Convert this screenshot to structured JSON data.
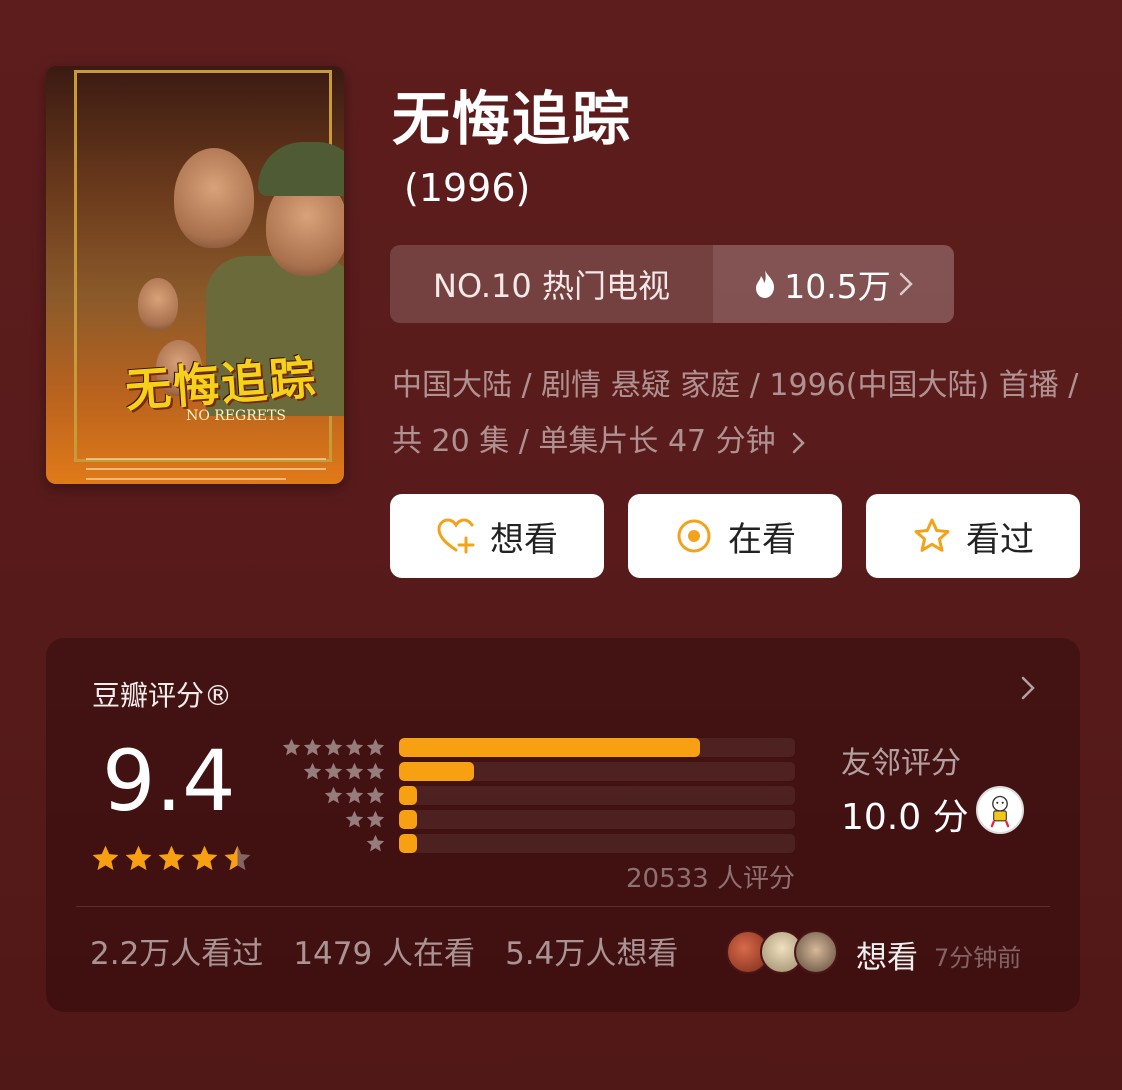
{
  "poster": {
    "title_text": "无悔追踪",
    "subtitle_text": "NO REGRETS"
  },
  "movie": {
    "title": "无悔追踪",
    "year": "(1996)"
  },
  "rank": {
    "label": "NO.10 热门电视",
    "hot_value": "10.5万"
  },
  "meta": {
    "line": "中国大陆 / 剧情 悬疑 家庭 / 1996(中国大陆) 首播 / 共 20 集 / 单集片长 47 分钟"
  },
  "actions": {
    "want": "想看",
    "watching": "在看",
    "watched": "看过"
  },
  "rating": {
    "label": "豆瓣评分®",
    "score": "9.4",
    "stars_value": 4.5,
    "distribution": [
      {
        "stars": 5,
        "fraction": 0.76
      },
      {
        "stars": 4,
        "fraction": 0.19
      },
      {
        "stars": 3,
        "fraction": 0.045
      },
      {
        "stars": 2,
        "fraction": 0.045
      },
      {
        "stars": 1,
        "fraction": 0.045
      }
    ],
    "count": "20533 人评分",
    "friends_label": "友邻评分",
    "friends_score": "10.0 分"
  },
  "stats": {
    "watched": "2.2万人看过",
    "watching": "1479 人在看",
    "want": "5.4万人想看"
  },
  "recent": {
    "action": "想看",
    "time": "7分钟前"
  },
  "colors": {
    "background": "#5e1d1d",
    "accent": "#f7a112",
    "button_bg": "#ffffff"
  }
}
